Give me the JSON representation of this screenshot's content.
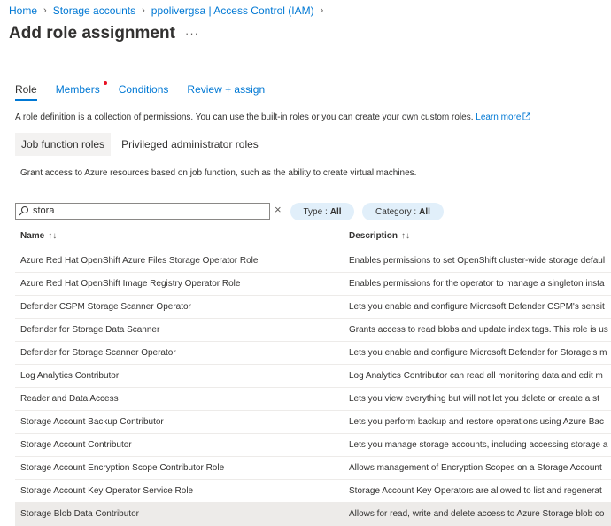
{
  "breadcrumb": [
    "Home",
    "Storage accounts",
    "ppolivergsa | Access Control (IAM)"
  ],
  "page_title": "Add role assignment",
  "more_label": "···",
  "tabs": [
    {
      "label": "Role",
      "active": true,
      "has_dot": false
    },
    {
      "label": "Members",
      "active": false,
      "has_dot": true
    },
    {
      "label": "Conditions",
      "active": false,
      "has_dot": false
    },
    {
      "label": "Review + assign",
      "active": false,
      "has_dot": false
    }
  ],
  "role_description": "A role definition is a collection of permissions. You can use the built-in roles or you can create your own custom roles.",
  "learn_more": "Learn more",
  "pivots": [
    {
      "label": "Job function roles",
      "active": true
    },
    {
      "label": "Privileged administrator roles",
      "active": false
    }
  ],
  "pivot_description": "Grant access to Azure resources based on job function, such as the ability to create virtual machines.",
  "search": {
    "value": "stora",
    "icon": "search-icon"
  },
  "clear_label": "×",
  "filters": {
    "type": {
      "label": "Type :",
      "value": "All"
    },
    "category": {
      "label": "Category :",
      "value": "All"
    }
  },
  "table": {
    "headers": {
      "name": "Name",
      "description": "Description",
      "sort_icon": "↑↓"
    },
    "rows": [
      {
        "name": "Azure Red Hat OpenShift Azure Files Storage Operator Role",
        "description": "Enables permissions to set OpenShift cluster-wide storage defaul"
      },
      {
        "name": "Azure Red Hat OpenShift Image Registry Operator Role",
        "description": "Enables permissions for the operator to manage a singleton insta"
      },
      {
        "name": "Defender CSPM Storage Scanner Operator",
        "description": "Lets you enable and configure Microsoft Defender CSPM's sensit"
      },
      {
        "name": "Defender for Storage Data Scanner",
        "description": "Grants access to read blobs and update index tags. This role is us"
      },
      {
        "name": "Defender for Storage Scanner Operator",
        "description": "Lets you enable and configure Microsoft Defender for Storage's m"
      },
      {
        "name": "Log Analytics Contributor",
        "description": "Log Analytics Contributor can read all monitoring data and edit m"
      },
      {
        "name": "Reader and Data Access",
        "description": "Lets you view everything but will not let you delete or create a st"
      },
      {
        "name": "Storage Account Backup Contributor",
        "description": "Lets you perform backup and restore operations using Azure Bac"
      },
      {
        "name": "Storage Account Contributor",
        "description": "Lets you manage storage accounts, including accessing storage a"
      },
      {
        "name": "Storage Account Encryption Scope Contributor Role",
        "description": "Allows management of Encryption Scopes on a Storage Account"
      },
      {
        "name": "Storage Account Key Operator Service Role",
        "description": "Storage Account Key Operators are allowed to list and regenerat"
      },
      {
        "name": "Storage Blob Data Contributor",
        "description": "Allows for read, write and delete access to Azure Storage blob co",
        "selected": true
      }
    ]
  },
  "colors": {
    "accent": "#0078d4",
    "pill_bg": "#e1effa",
    "selected_row": "#edebe9",
    "notify_dot": "#e81123"
  }
}
